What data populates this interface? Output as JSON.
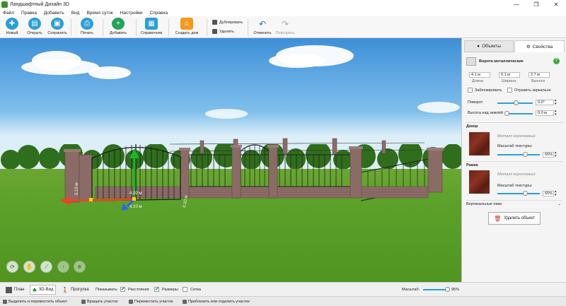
{
  "window": {
    "title": "Ландшафтный Дизайн 3D",
    "controls": [
      "—",
      "❐",
      "✕"
    ]
  },
  "menu": [
    "Файл",
    "Правка",
    "Добавить",
    "Вид",
    "Время суток",
    "Настройки",
    "Справка"
  ],
  "toolbar": {
    "new": "Новый",
    "open": "Открыть",
    "save": "Сохранить",
    "print": "Печать",
    "add": "Добавить",
    "reference": "Справочник",
    "create_house": "Создать дом",
    "duplicate": "Дублировать",
    "delete": "Удалить",
    "undo": "Отменить",
    "redo": "Повторить"
  },
  "viewport": {
    "dim_labels": {
      "x": "0.10 м",
      "z": "4.10 м",
      "y": "4.10 м",
      "depth": "0.10 м"
    }
  },
  "panel": {
    "tabs": {
      "objects": "Объекты",
      "properties": "Свойства"
    },
    "object_name": "Ворота металлические",
    "length_value": "4.1 м",
    "length_label": "Длина",
    "width_value": "0.1 м",
    "width_label": "Ширина",
    "height_value": "2.7 м",
    "height_label": "Высота",
    "lock_label": "Заблокировать",
    "mirror_label": "Отразить зеркально",
    "rotation_label": "Поворот",
    "rotation_value": "0.0°",
    "elevation_label": "Высота над землёй",
    "elevation_value": "0.0 м",
    "decor_title": "Декор",
    "decor_material": "Металл коричневый",
    "decor_scale_label": "Масштаб текстуры:",
    "decor_scale_value": "65%",
    "decor_scale": 0.65,
    "frame_title": "Рамка",
    "frame_material": "Металл коричневый",
    "frame_scale_label": "Масштаб текстуры:",
    "frame_scale_value": "65%",
    "frame_scale": 0.65,
    "vertical_peaks": "Вертикальные пики",
    "delete_object": "Удалить объект"
  },
  "bottom": {
    "plan": "План",
    "view3d": "3D-Вид",
    "walk": "Прогулка",
    "show_label": "Показывать:",
    "distances": "Расстояния",
    "sizes": "Размеры",
    "grid": "Сетка",
    "distances_checked": true,
    "sizes_checked": true,
    "grid_checked": false,
    "scale_label": "Масштаб:",
    "scale_value": "95%",
    "scale": 0.95
  },
  "status": {
    "hint1": "Выделить и переместить объект",
    "hint2": "Вращать участок",
    "hint3": "Переместить участок",
    "hint4": "Приблизить или отдалить участок"
  },
  "colors": {
    "accent": "#2aa0d8",
    "grass": "#5ca12a",
    "brick": "#8b6b66"
  }
}
